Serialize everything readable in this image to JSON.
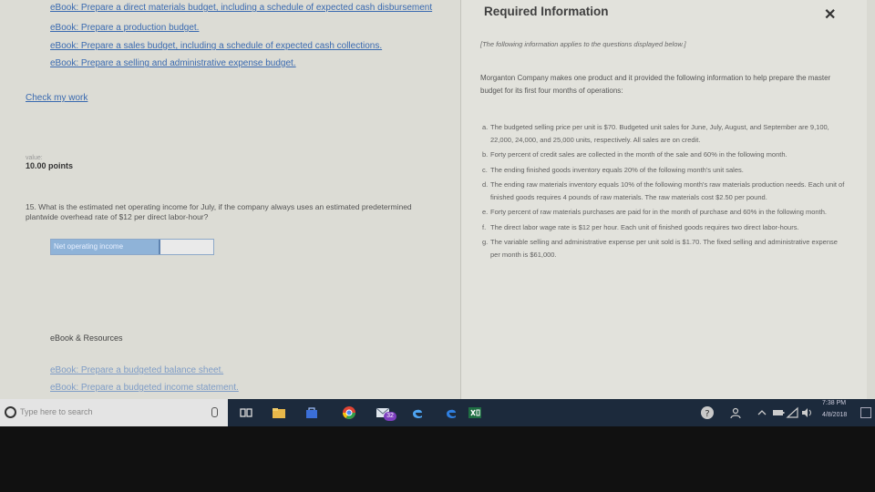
{
  "left_panel": {
    "ebook_links_top": [
      "eBook: Prepare a direct materials budget, including a schedule of expected cash disbursement",
      "eBook: Prepare a production budget.",
      "eBook: Prepare a sales budget, including a schedule of expected cash collections.",
      "eBook: Prepare a selling and administrative expense budget."
    ],
    "check_my_work": "Check my work",
    "value_label": "value:",
    "points": "10.00 points",
    "question": "15. What is the estimated net operating income for July, if the company always uses an estimated predetermined plantwide overhead rate of $12 per direct labor-hour?",
    "answer_label": "Net operating income",
    "answer_value": "",
    "ebook_resources": "eBook & Resources",
    "ebook_links_bottom": [
      "eBook: Prepare a budgeted balance sheet.",
      "eBook: Prepare a budgeted income statement."
    ]
  },
  "required_panel": {
    "title": "Required Information",
    "close_glyph": "✕",
    "intro": "[The following information applies to the questions displayed below.]",
    "description": "Morganton Company makes one product and it provided the following information to help prepare the master budget for its first four months of operations:",
    "items": [
      {
        "letter": "a.",
        "text": "The budgeted selling price per unit is $70. Budgeted unit sales for June, July, August, and September are 9,100, 22,000, 24,000, and 25,000 units, respectively. All sales are on credit."
      },
      {
        "letter": "b.",
        "text": "Forty percent of credit sales are collected in the month of the sale and 60% in the following month."
      },
      {
        "letter": "c.",
        "text": "The ending finished goods inventory equals 20% of the following month's unit sales."
      },
      {
        "letter": "d.",
        "text": "The ending raw materials inventory equals 10% of the following month's raw materials production needs. Each unit of finished goods requires 4 pounds of raw materials. The raw materials cost $2.50 per pound."
      },
      {
        "letter": "e.",
        "text": "Forty percent of raw materials purchases are paid for in the month of purchase and 60% in the following month."
      },
      {
        "letter": "f.",
        "text": "The direct labor wage rate is $12 per hour. Each unit of finished goods requires two direct labor-hours."
      },
      {
        "letter": "g.",
        "text": "The variable selling and administrative expense per unit sold is $1.70. The fixed selling and administrative expense per month is $61,000."
      }
    ]
  },
  "taskbar": {
    "search_placeholder": "Type here to search",
    "chrome_badge": "32",
    "time": "7:38 PM",
    "date": "4/8/2018",
    "icons": [
      "search-icon",
      "microphone-icon",
      "task-view-icon",
      "file-explorer-icon",
      "store-icon",
      "chrome-icon",
      "mail-icon",
      "edge-icon",
      "ie-icon",
      "excel-icon",
      "help-icon",
      "people-icon",
      "chevron-up-icon",
      "network-icon",
      "volume-icon",
      "notification-icon"
    ]
  },
  "colors": {
    "link": "#3a6ab0",
    "answer_label_bg": "#8fb3d8",
    "taskbar": "#1c2a3c"
  }
}
